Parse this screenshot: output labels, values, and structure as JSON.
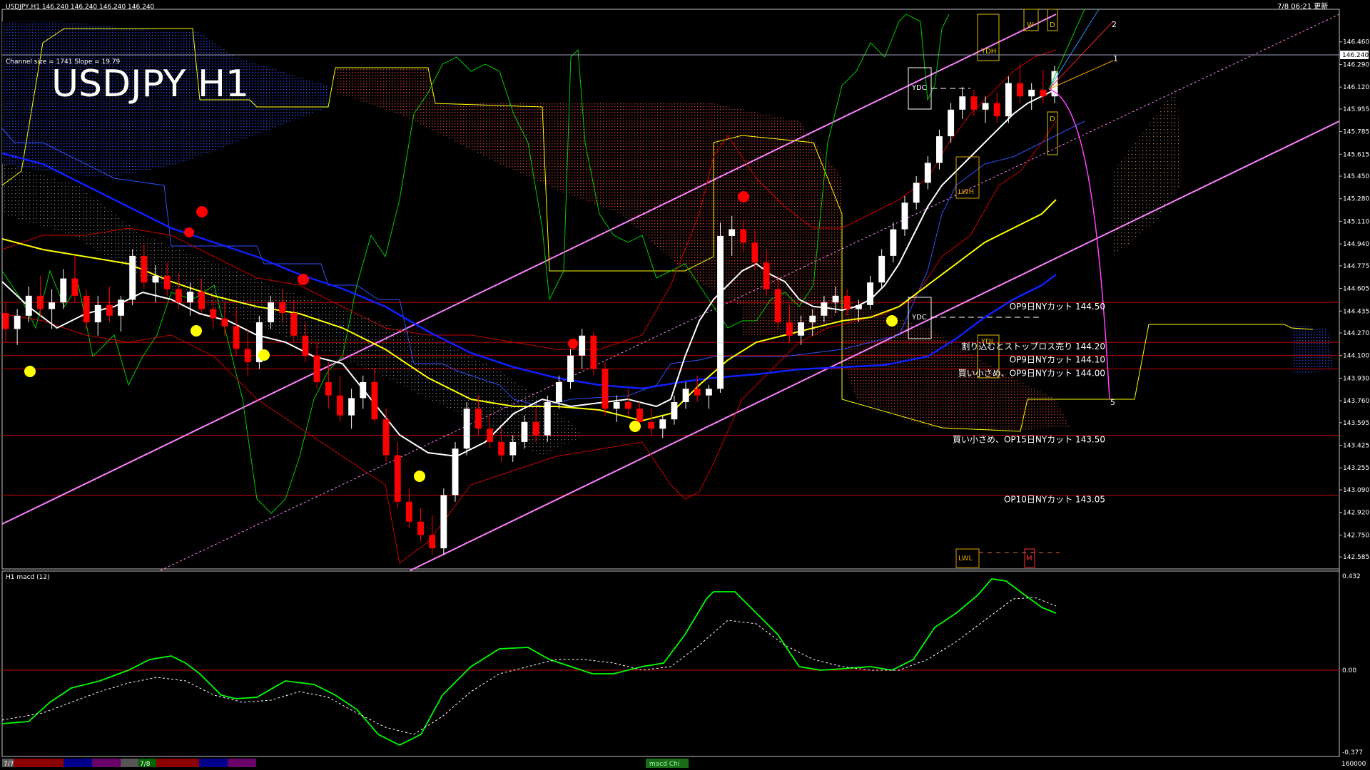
{
  "window": {
    "symbol_header": "USDJPY,H1  146.240 146.240 146.240 146.240",
    "timestamp": "7/8 06:21 更新",
    "channel_info": "Channel size = 1741 Slope = 19.79",
    "big_title": "USDJPY H1"
  },
  "price_panel": {
    "ylim": [
      142.5,
      146.7
    ],
    "ticks": [
      "146.460",
      "146.290",
      "146.240",
      "146.120",
      "145.955",
      "145.785",
      "145.615",
      "145.450",
      "145.280",
      "145.110",
      "144.940",
      "144.775",
      "144.605",
      "144.435",
      "144.270",
      "144.100",
      "143.930",
      "143.760",
      "143.595",
      "143.425",
      "143.255",
      "143.090",
      "142.920",
      "142.750",
      "142.585"
    ],
    "current_price": "146.240",
    "levels": [
      {
        "price": 144.5,
        "label": "OP9日NYカット 144.50"
      },
      {
        "price": 144.2,
        "label": "割り込むとストップロス売り 144.20"
      },
      {
        "price": 144.1,
        "label": "OP9日NYカット 144.10"
      },
      {
        "price": 144.0,
        "label": "買い小さめ、OP9日NYカット 144.00"
      },
      {
        "price": 143.5,
        "label": "買い小さめ、OP15日NYカット 143.50"
      },
      {
        "price": 143.05,
        "label": "OP10日NYカット 143.05"
      }
    ],
    "box_labels": [
      "YDH",
      "YDC",
      "YDC",
      "YDL",
      "LWH",
      "LWL",
      "W",
      "D",
      "D",
      "M"
    ],
    "fib_labels": [
      "2",
      "1",
      "5"
    ]
  },
  "macd_panel": {
    "label": "H1  macd (12)",
    "ticks": [
      "0.432",
      "0.00",
      "-0.377"
    ],
    "ylim": [
      -0.377,
      0.432
    ]
  },
  "bottom_bar": {
    "date_labels": [
      "7/7",
      "7/8"
    ],
    "tab": "macd Chi",
    "right_value": "160000"
  },
  "colors": {
    "background": "#000000",
    "bull_candle": "#ffffff",
    "bear_candle": "#ff0000",
    "ma_fast": "#ffffff",
    "ma_mid": "#ffff00",
    "ma_slow": "#0000ff",
    "channel": "#ff80ff",
    "level_line": "#c00000",
    "macd_up": "#00ff00",
    "macd_down": "#ff80a0",
    "cloud_red": "#ff4040",
    "cloud_blue": "#3050ff"
  },
  "chart_data": {
    "type": "candlestick",
    "timeframe": "H1",
    "symbol": "USDJPY",
    "ohlc": [
      [
        144.42,
        144.5,
        144.2,
        144.3
      ],
      [
        144.3,
        144.45,
        144.18,
        144.4
      ],
      [
        144.4,
        144.62,
        144.35,
        144.55
      ],
      [
        144.55,
        144.7,
        144.4,
        144.45
      ],
      [
        144.45,
        144.6,
        144.3,
        144.5
      ],
      [
        144.5,
        144.75,
        144.45,
        144.68
      ],
      [
        144.68,
        144.85,
        144.5,
        144.55
      ],
      [
        144.55,
        144.6,
        144.3,
        144.35
      ],
      [
        144.35,
        144.55,
        144.25,
        144.48
      ],
      [
        144.48,
        144.62,
        144.35,
        144.4
      ],
      [
        144.4,
        144.55,
        144.28,
        144.52
      ],
      [
        144.52,
        144.9,
        144.48,
        144.85
      ],
      [
        144.85,
        144.95,
        144.6,
        144.65
      ],
      [
        144.65,
        144.78,
        144.5,
        144.7
      ],
      [
        144.7,
        144.8,
        144.55,
        144.6
      ],
      [
        144.6,
        144.72,
        144.45,
        144.5
      ],
      [
        144.5,
        144.65,
        144.4,
        144.58
      ],
      [
        144.58,
        144.68,
        144.42,
        144.45
      ],
      [
        144.45,
        144.55,
        144.3,
        144.38
      ],
      [
        144.38,
        144.5,
        144.25,
        144.32
      ],
      [
        144.32,
        144.45,
        144.1,
        144.15
      ],
      [
        144.15,
        144.3,
        143.95,
        144.05
      ],
      [
        144.05,
        144.4,
        144.0,
        144.35
      ],
      [
        144.35,
        144.55,
        144.3,
        144.5
      ],
      [
        144.5,
        144.6,
        144.35,
        144.42
      ],
      [
        144.42,
        144.52,
        144.2,
        144.25
      ],
      [
        144.25,
        144.35,
        144.05,
        144.1
      ],
      [
        144.1,
        144.2,
        143.85,
        143.9
      ],
      [
        143.9,
        144.05,
        143.7,
        143.8
      ],
      [
        143.8,
        143.95,
        143.6,
        143.65
      ],
      [
        143.65,
        143.85,
        143.55,
        143.78
      ],
      [
        143.78,
        143.95,
        143.7,
        143.9
      ],
      [
        143.9,
        144.0,
        143.6,
        143.62
      ],
      [
        143.62,
        143.7,
        143.3,
        143.35
      ],
      [
        143.35,
        143.45,
        142.95,
        143.0
      ],
      [
        143.0,
        143.1,
        142.8,
        142.85
      ],
      [
        142.85,
        142.95,
        142.7,
        142.75
      ],
      [
        142.75,
        142.9,
        142.6,
        142.65
      ],
      [
        142.65,
        143.1,
        142.6,
        143.05
      ],
      [
        143.05,
        143.45,
        143.0,
        143.4
      ],
      [
        143.4,
        143.75,
        143.35,
        143.7
      ],
      [
        143.7,
        143.8,
        143.5,
        143.55
      ],
      [
        143.55,
        143.65,
        143.4,
        143.45
      ],
      [
        143.45,
        143.55,
        143.3,
        143.35
      ],
      [
        143.35,
        143.5,
        143.3,
        143.45
      ],
      [
        143.45,
        143.65,
        143.4,
        143.6
      ],
      [
        143.6,
        143.7,
        143.45,
        143.5
      ],
      [
        143.5,
        143.8,
        143.45,
        143.75
      ],
      [
        143.75,
        143.95,
        143.7,
        143.9
      ],
      [
        143.9,
        144.15,
        143.85,
        144.1
      ],
      [
        144.1,
        144.3,
        144.0,
        144.25
      ],
      [
        144.25,
        144.28,
        143.95,
        144.0
      ],
      [
        144.0,
        144.05,
        143.65,
        143.7
      ],
      [
        143.7,
        143.8,
        143.6,
        143.75
      ],
      [
        143.75,
        143.85,
        143.65,
        143.7
      ],
      [
        143.7,
        143.75,
        143.55,
        143.6
      ],
      [
        143.6,
        143.7,
        143.5,
        143.55
      ],
      [
        143.55,
        143.65,
        143.48,
        143.62
      ],
      [
        143.62,
        143.8,
        143.58,
        143.75
      ],
      [
        143.75,
        143.9,
        143.7,
        143.85
      ],
      [
        143.85,
        143.95,
        143.75,
        143.8
      ],
      [
        143.8,
        143.88,
        143.7,
        143.85
      ],
      [
        143.85,
        145.1,
        143.82,
        145.0
      ],
      [
        145.0,
        145.15,
        144.85,
        145.05
      ],
      [
        145.05,
        145.12,
        144.88,
        144.95
      ],
      [
        144.95,
        145.05,
        144.75,
        144.8
      ],
      [
        144.8,
        144.9,
        144.55,
        144.6
      ],
      [
        144.6,
        144.7,
        144.3,
        144.35
      ],
      [
        144.35,
        144.48,
        144.2,
        144.25
      ],
      [
        144.25,
        144.4,
        144.18,
        144.35
      ],
      [
        144.35,
        144.45,
        144.25,
        144.4
      ],
      [
        144.4,
        144.55,
        144.35,
        144.5
      ],
      [
        144.5,
        144.62,
        144.42,
        144.55
      ],
      [
        144.55,
        144.6,
        144.4,
        144.45
      ],
      [
        144.45,
        144.52,
        144.35,
        144.48
      ],
      [
        144.48,
        144.7,
        144.45,
        144.65
      ],
      [
        144.65,
        144.9,
        144.6,
        144.85
      ],
      [
        144.85,
        145.1,
        144.8,
        145.05
      ],
      [
        145.05,
        145.3,
        145.0,
        145.25
      ],
      [
        145.25,
        145.45,
        145.2,
        145.4
      ],
      [
        145.4,
        145.6,
        145.35,
        145.55
      ],
      [
        145.55,
        145.8,
        145.5,
        145.75
      ],
      [
        145.75,
        146.0,
        145.7,
        145.95
      ],
      [
        145.95,
        146.12,
        145.88,
        146.05
      ],
      [
        146.05,
        146.1,
        145.9,
        145.95
      ],
      [
        145.95,
        146.05,
        145.85,
        146.0
      ],
      [
        146.0,
        146.08,
        145.85,
        145.9
      ],
      [
        145.9,
        146.2,
        145.85,
        146.15
      ],
      [
        146.15,
        146.3,
        146.0,
        146.05
      ],
      [
        146.05,
        146.15,
        145.95,
        146.1
      ],
      [
        146.1,
        146.25,
        146.0,
        146.05
      ],
      [
        146.05,
        146.28,
        146.0,
        146.24
      ]
    ]
  }
}
